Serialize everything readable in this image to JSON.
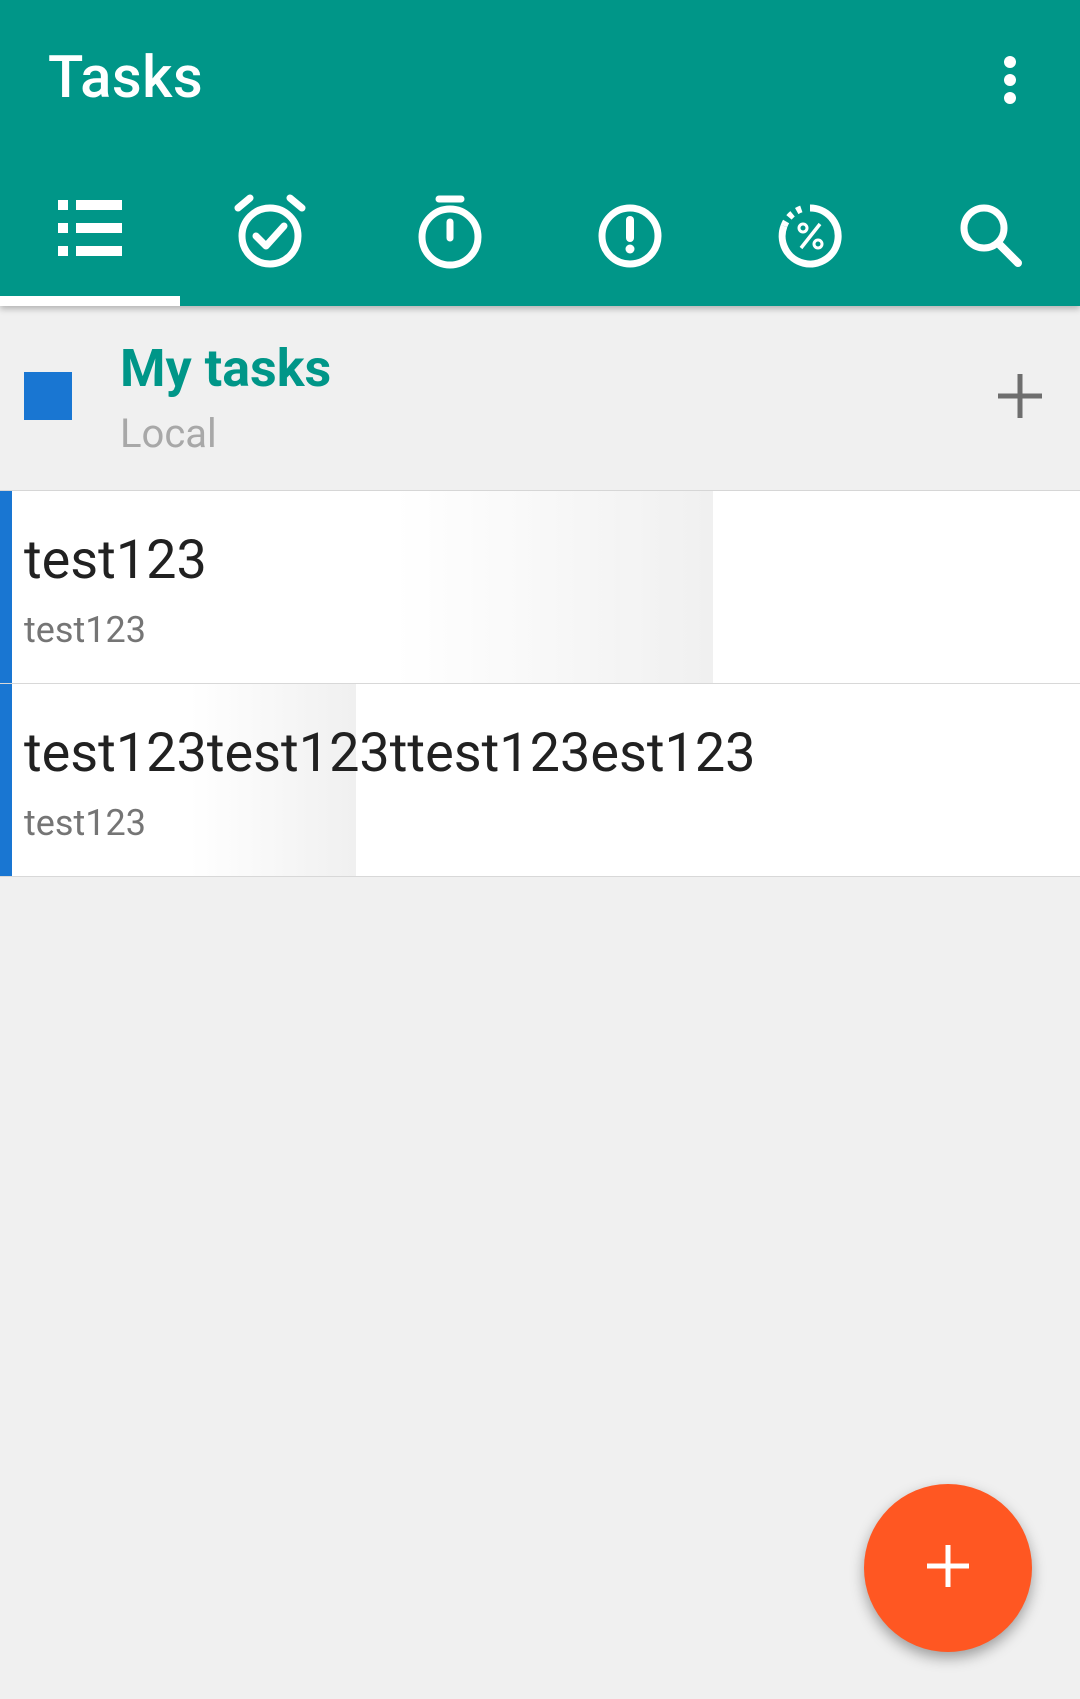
{
  "app": {
    "title": "Tasks"
  },
  "colors": {
    "primary": "#009688",
    "accent": "#ff5722",
    "list_color": "#1976d2"
  },
  "tabs": [
    {
      "name": "all-tasks",
      "icon": "list-icon",
      "selected": true
    },
    {
      "name": "due",
      "icon": "alarm-check-icon",
      "selected": false
    },
    {
      "name": "start",
      "icon": "stopwatch-icon",
      "selected": false
    },
    {
      "name": "priority",
      "icon": "alert-circle-icon",
      "selected": false
    },
    {
      "name": "progress",
      "icon": "progress-percent-icon",
      "selected": false
    },
    {
      "name": "search",
      "icon": "search-icon",
      "selected": false
    }
  ],
  "list": {
    "name": "My tasks",
    "account": "Local"
  },
  "tasks": [
    {
      "title": "test123",
      "description": "test123"
    },
    {
      "title": "test123test123ttest123est123",
      "description": "test123"
    }
  ],
  "fab": {
    "icon": "plus-icon"
  }
}
